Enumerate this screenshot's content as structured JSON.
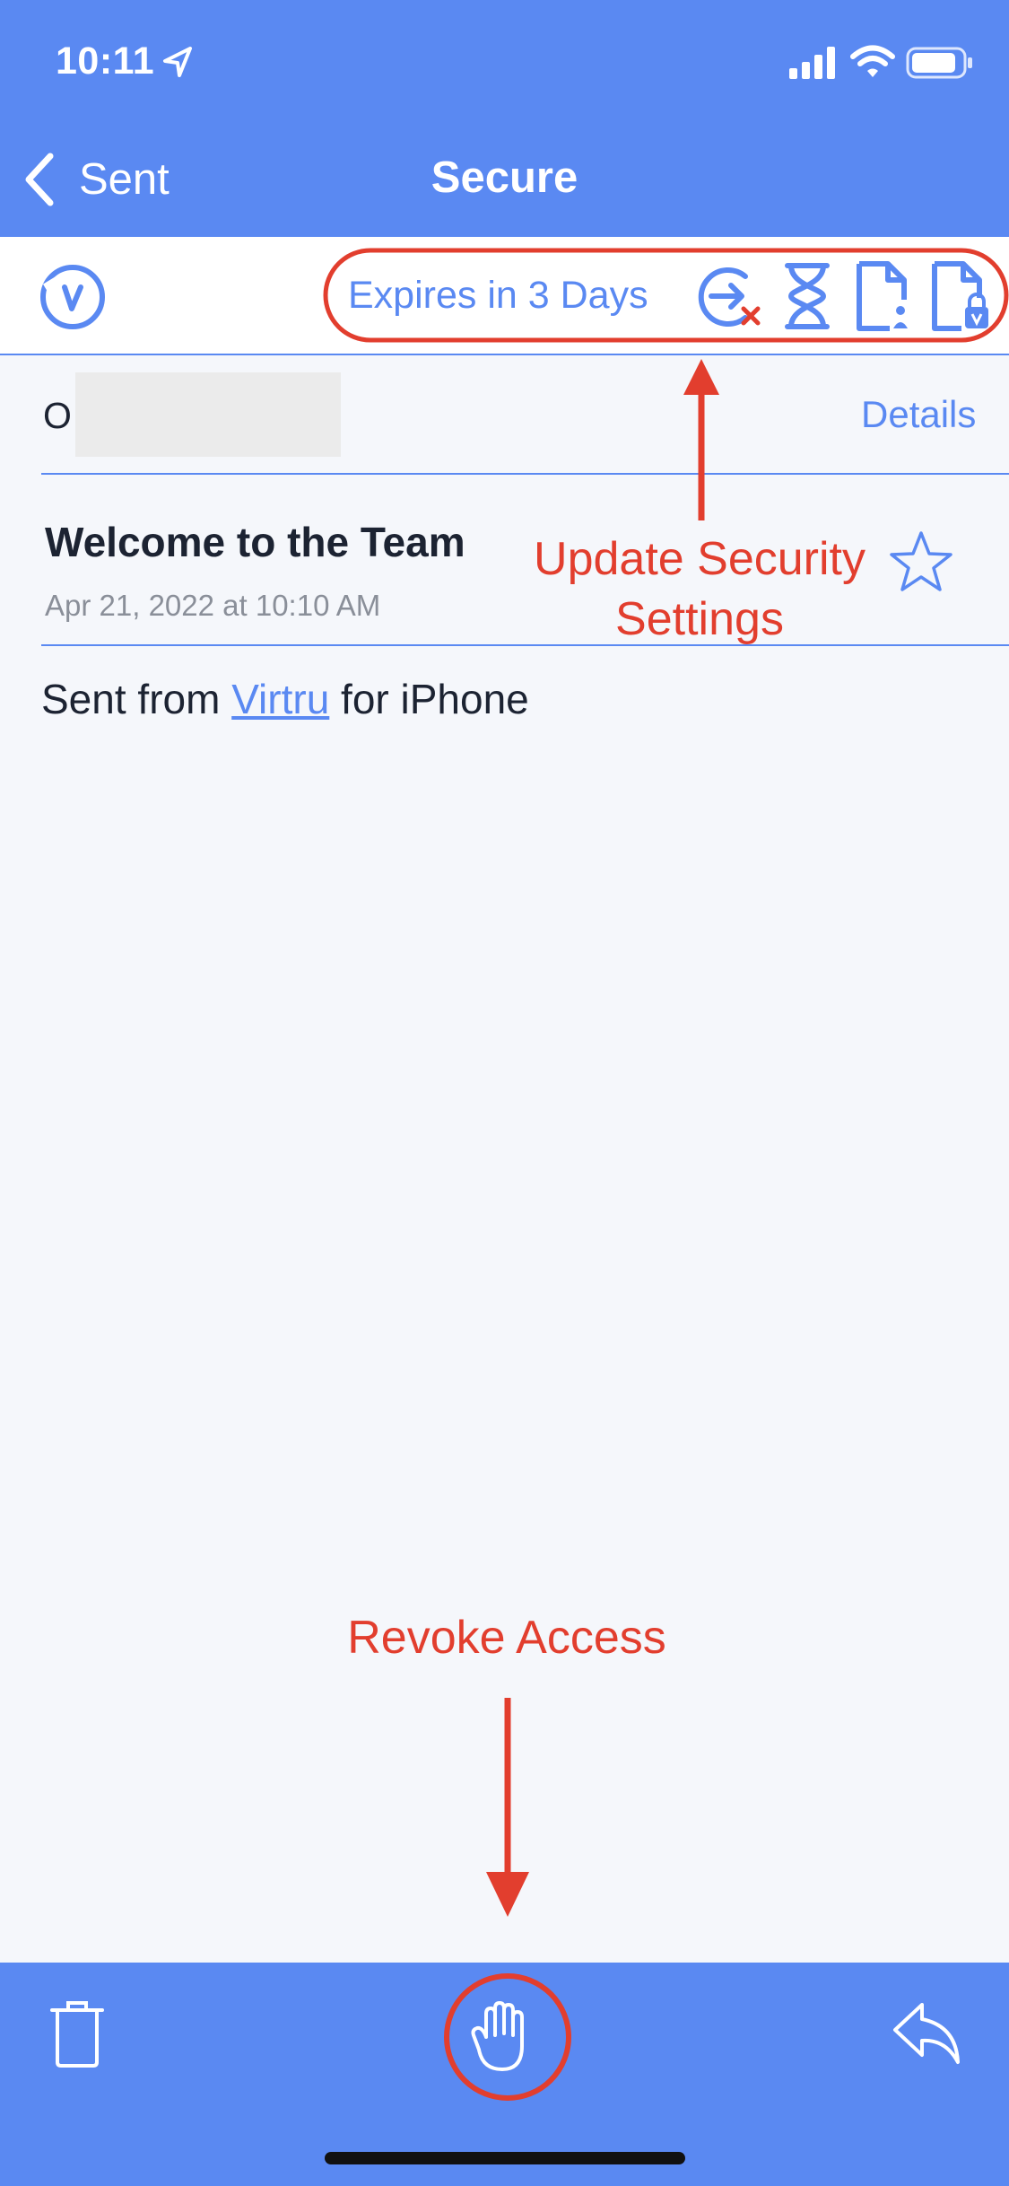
{
  "status_bar": {
    "time": "10:11"
  },
  "nav": {
    "back_label": "Sent",
    "title": "Secure"
  },
  "security_bar": {
    "expires_text": "Expires in 3 Days"
  },
  "email": {
    "sender_initial": "O",
    "details_label": "Details",
    "subject": "Welcome to the Team",
    "datetime": "Apr 21, 2022 at 10:10 AM",
    "body_prefix": "Sent from ",
    "body_link": "Virtru",
    "body_suffix": " for iPhone"
  },
  "annotations": {
    "update_line1": "Update Security",
    "update_line2": "Settings",
    "revoke": "Revoke Access"
  },
  "colors": {
    "brand": "#5a89f2",
    "annotation": "#e23e2e",
    "background": "#f5f7fb",
    "text": "#1c2332"
  },
  "icons": {
    "status": [
      "location-arrow-icon",
      "signal-icon",
      "wifi-icon",
      "battery-icon"
    ],
    "security": [
      "virtru-logo-icon",
      "disable-forwarding-icon",
      "expiration-hourglass-icon",
      "watermark-file-icon",
      "persistent-protection-file-icon"
    ],
    "actions": [
      "star-icon",
      "trash-icon",
      "revoke-hand-icon",
      "reply-icon"
    ]
  }
}
